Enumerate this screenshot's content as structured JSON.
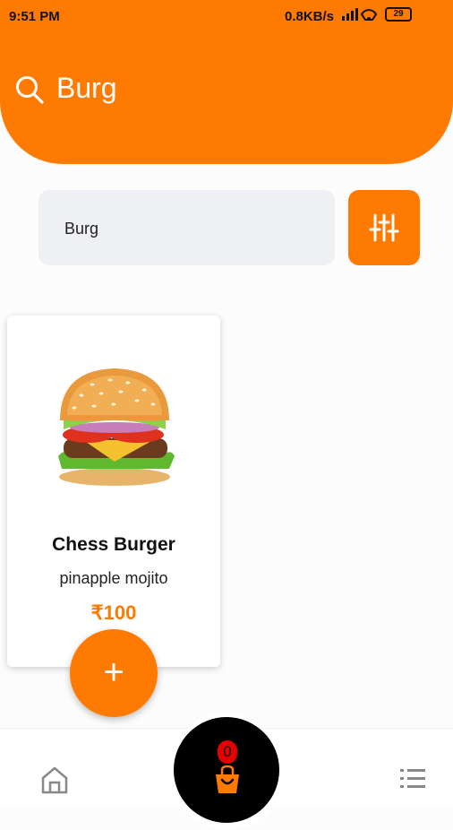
{
  "status_bar": {
    "time": "9:51 PM",
    "network_speed": "0.8KB/s",
    "battery": "29"
  },
  "header": {
    "title": "Burg",
    "icon": "search-icon"
  },
  "search": {
    "value": "Burg"
  },
  "product": {
    "name": "Chess Burger",
    "description": "pinapple mojito",
    "price": "₹100"
  },
  "add_button": {
    "label": "+"
  },
  "cart": {
    "count": "0"
  },
  "colors": {
    "accent": "#FF7A00",
    "badge": "#E40000",
    "search_bg": "#eef0f3"
  },
  "nav": {
    "left_icon": "home-icon",
    "center_icon": "shopping-bag-icon",
    "right_icon": "menu-list-icon"
  }
}
